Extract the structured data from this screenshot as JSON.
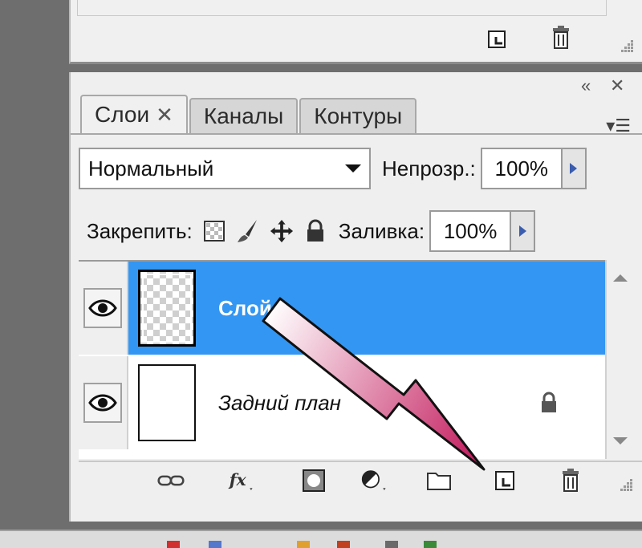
{
  "panel": {
    "tabs": [
      {
        "label": "Слои",
        "active": true,
        "close": "✕"
      },
      {
        "label": "Каналы",
        "active": false
      },
      {
        "label": "Контуры",
        "active": false
      }
    ],
    "blend_mode": "Нормальный",
    "opacity_label": "Непрозр.:",
    "opacity_value": "100%",
    "lock_label": "Закрепить:",
    "fill_label": "Заливка:",
    "fill_value": "100%"
  },
  "layers": [
    {
      "name": "Слой 1",
      "selected": true,
      "visible": true,
      "thumbnail": "transparent-checker",
      "locked": false
    },
    {
      "name": "Задний план",
      "selected": false,
      "visible": true,
      "thumbnail": "white",
      "locked": true
    }
  ],
  "bottom_toolbar": {
    "icons": [
      "link-icon",
      "fx-icon",
      "mask-icon",
      "adjustment-icon",
      "folder-icon",
      "new-layer-icon",
      "trash-icon"
    ]
  },
  "colors": {
    "selection": "#3396f2",
    "arrow_start": "#ffffff",
    "arrow_end": "#c2185b"
  }
}
